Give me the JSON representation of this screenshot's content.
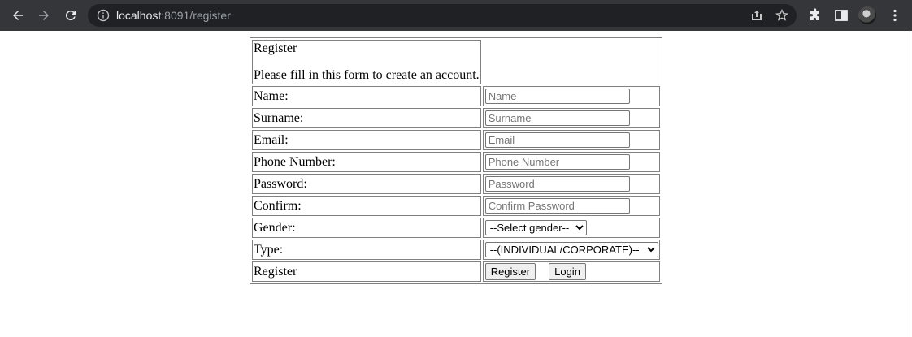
{
  "browser": {
    "url_host": "localhost",
    "url_rest": ":8091/register"
  },
  "form": {
    "title": "Register",
    "subtitle": "Please fill in this form to create an account.",
    "fields": [
      {
        "label": "Name:",
        "placeholder": "Name",
        "value": ""
      },
      {
        "label": "Surname:",
        "placeholder": "Surname",
        "value": ""
      },
      {
        "label": "Email:",
        "placeholder": "Email",
        "value": ""
      },
      {
        "label": "Phone Number:",
        "placeholder": "Phone Number",
        "value": ""
      },
      {
        "label": "Password:",
        "placeholder": "Password",
        "value": ""
      },
      {
        "label": "Confirm:",
        "placeholder": "Confirm Password",
        "value": ""
      }
    ],
    "gender": {
      "label": "Gender:",
      "selected": "--Select gender--"
    },
    "type": {
      "label": "Type:",
      "selected": "--(INDIVIDUAL/CORPORATE)--"
    },
    "actions": {
      "label": "Register",
      "register_button": "Register",
      "login_button": "Login"
    }
  },
  "colors": {
    "chrome_bg": "#35363a",
    "omnibox_bg": "#202124",
    "cell_border": "#808080"
  }
}
